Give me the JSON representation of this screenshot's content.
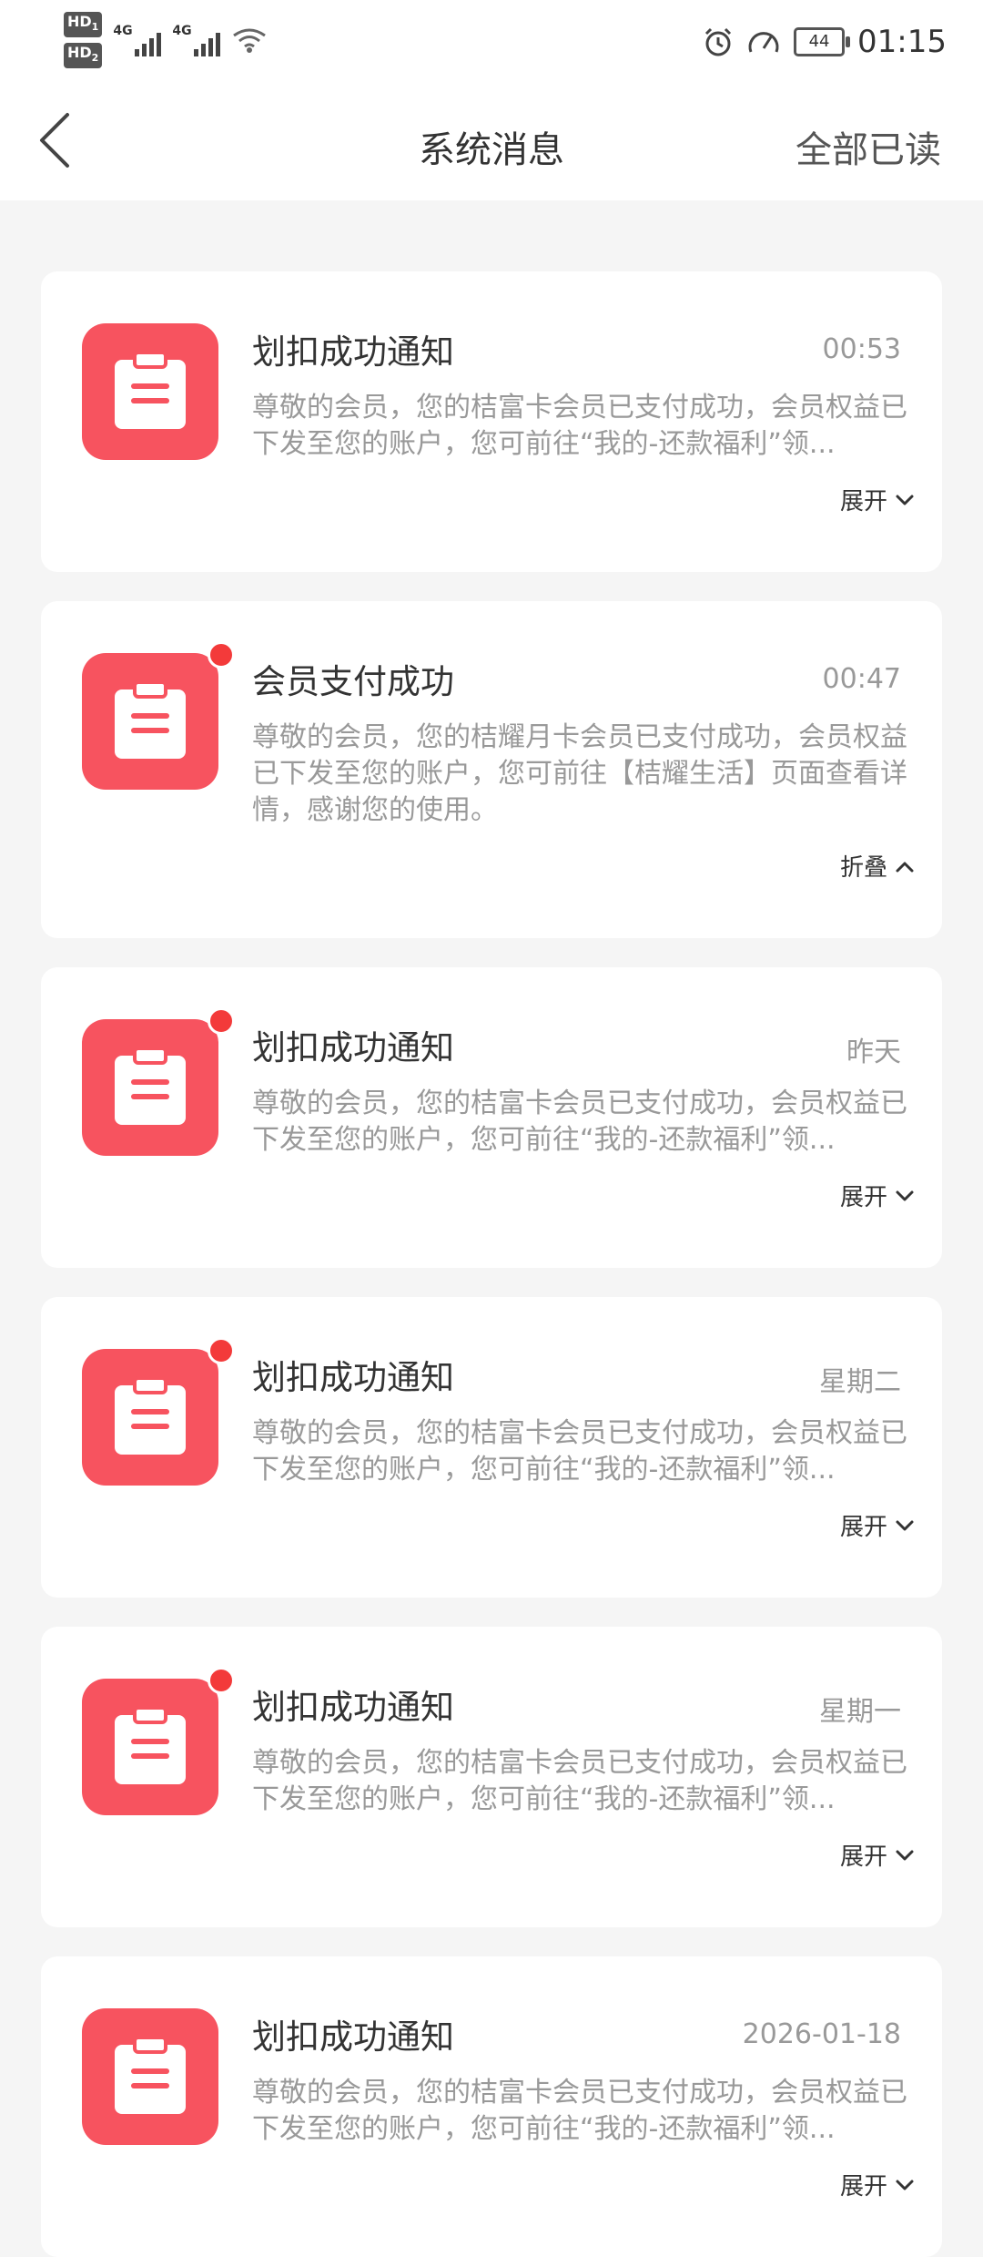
{
  "status_bar": {
    "time": "01:15",
    "battery": "44",
    "hd1": "HD",
    "hd2": "HD",
    "net1": "4G",
    "net2": "4G",
    "icons": [
      "hd-icon",
      "signal-icon",
      "wifi-icon",
      "alarm-icon",
      "speed-icon",
      "battery-icon"
    ]
  },
  "nav": {
    "title": "系统消息",
    "mark_all_read": "全部已读",
    "back_icon": "back-arrow-icon"
  },
  "messages": [
    {
      "title": "划扣成功通知",
      "time": "00:53",
      "body": "尊敬的会员，您的桔富卡会员已支付成功，会员权益已下发至您的账户，您可前往“我的-还款福利”领...",
      "toggle": "展开",
      "unread": false,
      "expanded": false
    },
    {
      "title": "会员支付成功",
      "time": "00:47",
      "body": "尊敬的会员，您的桔耀月卡会员已支付成功，会员权益已下发至您的账户，您可前往【桔耀生活】页面查看详情，感谢您的使用。",
      "toggle": "折叠",
      "unread": true,
      "expanded": true
    },
    {
      "title": "划扣成功通知",
      "time": "昨天",
      "body": "尊敬的会员，您的桔富卡会员已支付成功，会员权益已下发至您的账户，您可前往“我的-还款福利”领...",
      "toggle": "展开",
      "unread": true,
      "expanded": false
    },
    {
      "title": "划扣成功通知",
      "time": "星期二",
      "body": "尊敬的会员，您的桔富卡会员已支付成功，会员权益已下发至您的账户，您可前往“我的-还款福利”领...",
      "toggle": "展开",
      "unread": true,
      "expanded": false
    },
    {
      "title": "划扣成功通知",
      "time": "星期一",
      "body": "尊敬的会员，您的桔富卡会员已支付成功，会员权益已下发至您的账户，您可前往“我的-还款福利”领...",
      "toggle": "展开",
      "unread": true,
      "expanded": false
    },
    {
      "title": "划扣成功通知",
      "time": "2026-01-18",
      "body": "尊敬的会员，您的桔富卡会员已支付成功，会员权益已下发至您的账户，您可前往“我的-还款福利”领...",
      "toggle": "展开",
      "unread": false,
      "expanded": false
    }
  ],
  "colors": {
    "accent": "#f7535f",
    "unread_dot": "#f33a3a",
    "background": "#f5f5f5"
  }
}
